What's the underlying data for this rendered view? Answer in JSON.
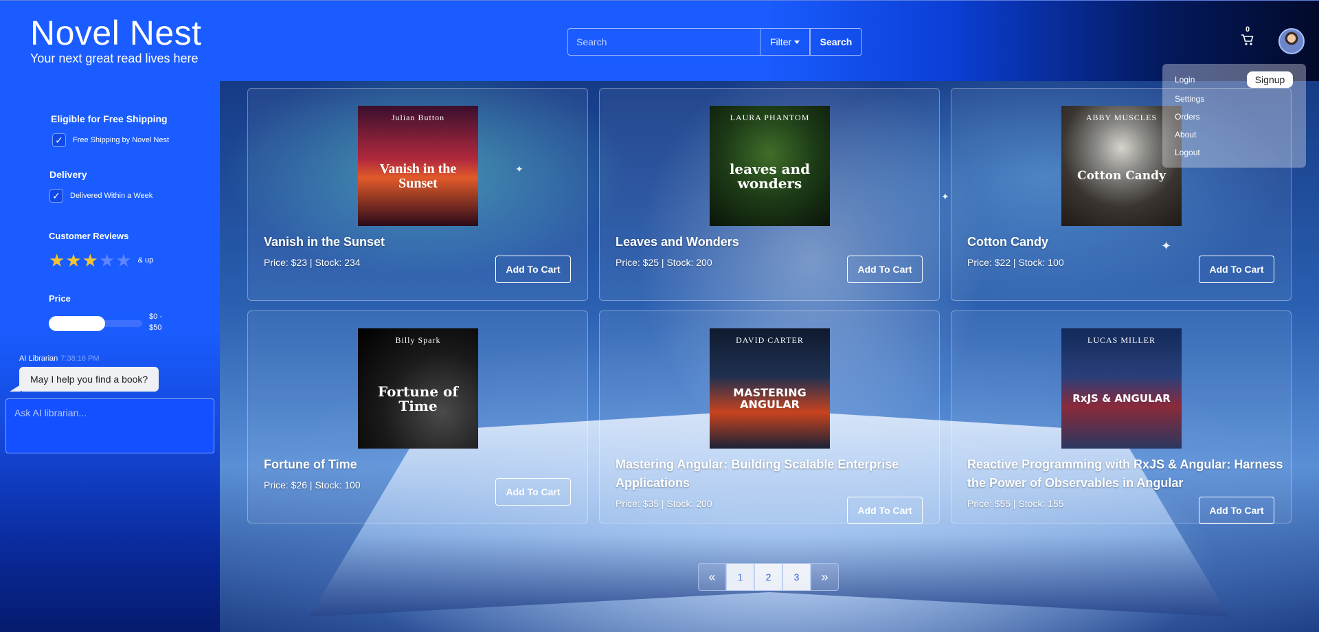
{
  "header": {
    "brand_title": "Novel Nest",
    "brand_tagline": "Your next great read lives here",
    "search_placeholder": "Search",
    "filter_label": "Filter",
    "search_button": "Search",
    "cart_count": "0"
  },
  "sidebar": {
    "shipping": {
      "heading": "Eligible for Free Shipping",
      "option": "Free Shipping by Novel Nest",
      "checked": true
    },
    "delivery": {
      "heading": "Delivery",
      "option": "Delivered Within a Week",
      "checked": true
    },
    "reviews": {
      "heading": "Customer Reviews",
      "rating": 3,
      "max": 5,
      "suffix": "& up"
    },
    "price": {
      "heading": "Price",
      "range_label_1": "$0 -",
      "range_label_2": "$50",
      "fill_fraction": 0.6
    },
    "ai": {
      "name": "AI Librarian",
      "time": "7:38:16 PM",
      "message": "May I help you find a book?",
      "input_placeholder": "Ask AI librarian..."
    }
  },
  "products": [
    {
      "title": "Vanish in the Sunset",
      "meta": "Price: $23 | Stock: 234",
      "cover_author": "Julian Button",
      "cover_title": "Vanish in the Sunset",
      "button": "Add To Cart"
    },
    {
      "title": "Leaves and Wonders",
      "meta": "Price: $25 | Stock: 200",
      "cover_author": "LAURA PHANTOM",
      "cover_title": "leaves and wonders",
      "button": "Add To Cart"
    },
    {
      "title": "Cotton Candy",
      "meta": "Price: $22 | Stock: 100",
      "cover_author": "ABBY MUSCLES",
      "cover_title": "Cotton Candy",
      "button": "Add To Cart"
    },
    {
      "title": "Fortune of Time",
      "meta": "Price: $26 | Stock: 100",
      "cover_author": "Billy Spark",
      "cover_title": "Fortune of Time",
      "button": "Add To Cart"
    },
    {
      "title": "Mastering Angular: Building Scalable Enterprise Applications",
      "meta": "Price: $35 | Stock: 200",
      "cover_author": "DAVID CARTER",
      "cover_title": "MASTERING ANGULAR",
      "button": "Add To Cart"
    },
    {
      "title": "Reactive Programming with RxJS & Angular: Harness the Power of Observables in Angular",
      "meta": "Price: $55 | Stock: 155",
      "cover_author": "LUCAS MILLER",
      "cover_title": "RxJS & ANGULAR",
      "button": "Add To Cart"
    }
  ],
  "pagination": {
    "prev": "«",
    "pages": [
      "1",
      "2",
      "3"
    ],
    "next": "»",
    "active": "1"
  },
  "menu": {
    "items": [
      "Login",
      "Settings",
      "Orders",
      "About",
      "Logout"
    ],
    "signup": "Signup"
  }
}
